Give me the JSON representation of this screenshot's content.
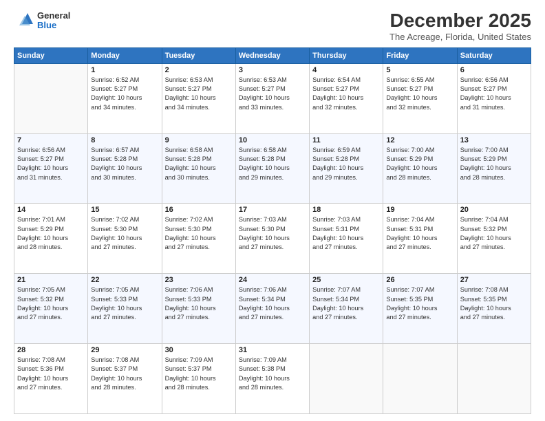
{
  "logo": {
    "general": "General",
    "blue": "Blue"
  },
  "header": {
    "title": "December 2025",
    "subtitle": "The Acreage, Florida, United States"
  },
  "days_of_week": [
    "Sunday",
    "Monday",
    "Tuesday",
    "Wednesday",
    "Thursday",
    "Friday",
    "Saturday"
  ],
  "weeks": [
    [
      {
        "day": "",
        "info": ""
      },
      {
        "day": "1",
        "info": "Sunrise: 6:52 AM\nSunset: 5:27 PM\nDaylight: 10 hours\nand 34 minutes."
      },
      {
        "day": "2",
        "info": "Sunrise: 6:53 AM\nSunset: 5:27 PM\nDaylight: 10 hours\nand 34 minutes."
      },
      {
        "day": "3",
        "info": "Sunrise: 6:53 AM\nSunset: 5:27 PM\nDaylight: 10 hours\nand 33 minutes."
      },
      {
        "day": "4",
        "info": "Sunrise: 6:54 AM\nSunset: 5:27 PM\nDaylight: 10 hours\nand 32 minutes."
      },
      {
        "day": "5",
        "info": "Sunrise: 6:55 AM\nSunset: 5:27 PM\nDaylight: 10 hours\nand 32 minutes."
      },
      {
        "day": "6",
        "info": "Sunrise: 6:56 AM\nSunset: 5:27 PM\nDaylight: 10 hours\nand 31 minutes."
      }
    ],
    [
      {
        "day": "7",
        "info": "Sunrise: 6:56 AM\nSunset: 5:27 PM\nDaylight: 10 hours\nand 31 minutes."
      },
      {
        "day": "8",
        "info": "Sunrise: 6:57 AM\nSunset: 5:28 PM\nDaylight: 10 hours\nand 30 minutes."
      },
      {
        "day": "9",
        "info": "Sunrise: 6:58 AM\nSunset: 5:28 PM\nDaylight: 10 hours\nand 30 minutes."
      },
      {
        "day": "10",
        "info": "Sunrise: 6:58 AM\nSunset: 5:28 PM\nDaylight: 10 hours\nand 29 minutes."
      },
      {
        "day": "11",
        "info": "Sunrise: 6:59 AM\nSunset: 5:28 PM\nDaylight: 10 hours\nand 29 minutes."
      },
      {
        "day": "12",
        "info": "Sunrise: 7:00 AM\nSunset: 5:29 PM\nDaylight: 10 hours\nand 28 minutes."
      },
      {
        "day": "13",
        "info": "Sunrise: 7:00 AM\nSunset: 5:29 PM\nDaylight: 10 hours\nand 28 minutes."
      }
    ],
    [
      {
        "day": "14",
        "info": "Sunrise: 7:01 AM\nSunset: 5:29 PM\nDaylight: 10 hours\nand 28 minutes."
      },
      {
        "day": "15",
        "info": "Sunrise: 7:02 AM\nSunset: 5:30 PM\nDaylight: 10 hours\nand 27 minutes."
      },
      {
        "day": "16",
        "info": "Sunrise: 7:02 AM\nSunset: 5:30 PM\nDaylight: 10 hours\nand 27 minutes."
      },
      {
        "day": "17",
        "info": "Sunrise: 7:03 AM\nSunset: 5:30 PM\nDaylight: 10 hours\nand 27 minutes."
      },
      {
        "day": "18",
        "info": "Sunrise: 7:03 AM\nSunset: 5:31 PM\nDaylight: 10 hours\nand 27 minutes."
      },
      {
        "day": "19",
        "info": "Sunrise: 7:04 AM\nSunset: 5:31 PM\nDaylight: 10 hours\nand 27 minutes."
      },
      {
        "day": "20",
        "info": "Sunrise: 7:04 AM\nSunset: 5:32 PM\nDaylight: 10 hours\nand 27 minutes."
      }
    ],
    [
      {
        "day": "21",
        "info": "Sunrise: 7:05 AM\nSunset: 5:32 PM\nDaylight: 10 hours\nand 27 minutes."
      },
      {
        "day": "22",
        "info": "Sunrise: 7:05 AM\nSunset: 5:33 PM\nDaylight: 10 hours\nand 27 minutes."
      },
      {
        "day": "23",
        "info": "Sunrise: 7:06 AM\nSunset: 5:33 PM\nDaylight: 10 hours\nand 27 minutes."
      },
      {
        "day": "24",
        "info": "Sunrise: 7:06 AM\nSunset: 5:34 PM\nDaylight: 10 hours\nand 27 minutes."
      },
      {
        "day": "25",
        "info": "Sunrise: 7:07 AM\nSunset: 5:34 PM\nDaylight: 10 hours\nand 27 minutes."
      },
      {
        "day": "26",
        "info": "Sunrise: 7:07 AM\nSunset: 5:35 PM\nDaylight: 10 hours\nand 27 minutes."
      },
      {
        "day": "27",
        "info": "Sunrise: 7:08 AM\nSunset: 5:35 PM\nDaylight: 10 hours\nand 27 minutes."
      }
    ],
    [
      {
        "day": "28",
        "info": "Sunrise: 7:08 AM\nSunset: 5:36 PM\nDaylight: 10 hours\nand 27 minutes."
      },
      {
        "day": "29",
        "info": "Sunrise: 7:08 AM\nSunset: 5:37 PM\nDaylight: 10 hours\nand 28 minutes."
      },
      {
        "day": "30",
        "info": "Sunrise: 7:09 AM\nSunset: 5:37 PM\nDaylight: 10 hours\nand 28 minutes."
      },
      {
        "day": "31",
        "info": "Sunrise: 7:09 AM\nSunset: 5:38 PM\nDaylight: 10 hours\nand 28 minutes."
      },
      {
        "day": "",
        "info": ""
      },
      {
        "day": "",
        "info": ""
      },
      {
        "day": "",
        "info": ""
      }
    ]
  ]
}
